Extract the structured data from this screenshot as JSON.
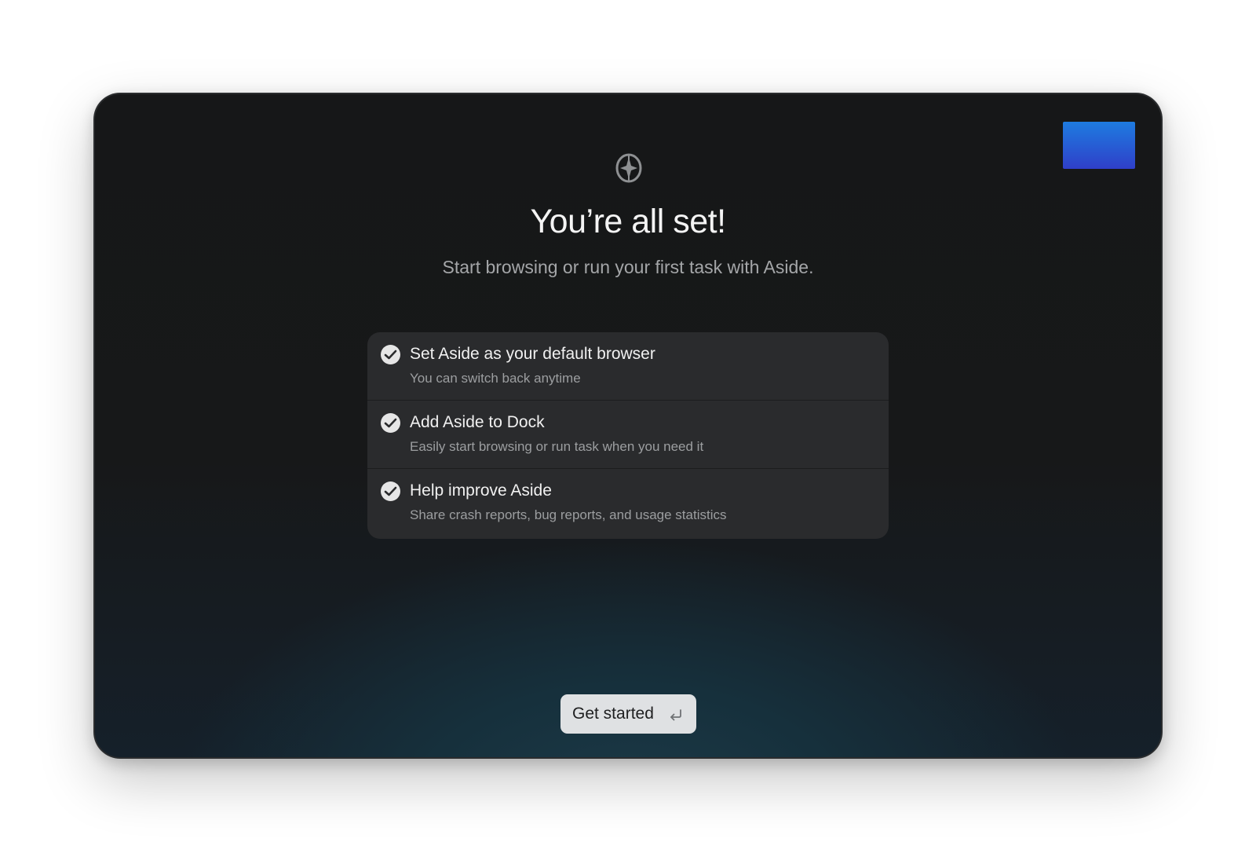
{
  "onboarding": {
    "logo_icon": "aside-logo-icon",
    "title": "You’re all set!",
    "subtitle": "Start browsing or run your first task with Aside.",
    "options": [
      {
        "title": "Set Aside as your default browser",
        "description": "You can switch back anytime",
        "checked": true,
        "icon": "checkmark-icon"
      },
      {
        "title": "Add Aside to Dock",
        "description": "Easily start browsing or run task when you need it",
        "checked": true,
        "icon": "checkmark-icon"
      },
      {
        "title": "Help improve Aside",
        "description": "Share crash reports, bug reports, and usage statistics",
        "checked": true,
        "icon": "checkmark-icon"
      }
    ],
    "cta_label": "Get started",
    "cta_icon": "enter-key-icon"
  },
  "colors": {
    "window_background": "#171819",
    "glow": "#1c3a48",
    "card_background": "#2a2b2d",
    "checkbox": "#e6e6e6",
    "button_background": "#dfe1e3",
    "corner_swatch_top": "#1e7ce0",
    "corner_swatch_bottom": "#2f3fc9"
  }
}
